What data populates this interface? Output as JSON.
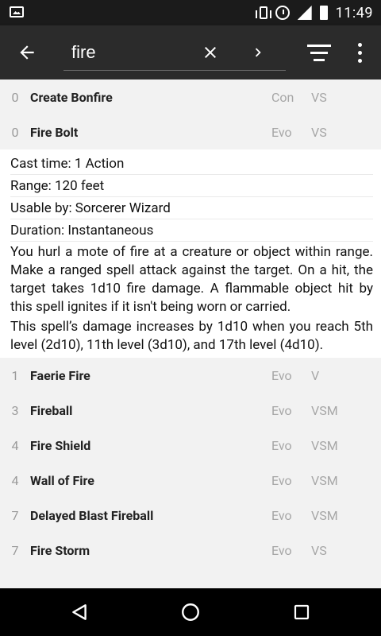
{
  "status_bar": {
    "time": "11:49"
  },
  "search": {
    "value": "fire",
    "placeholder": ""
  },
  "spells_top": [
    {
      "level": "0",
      "name": "Create Bonfire",
      "school": "Con",
      "components": "VS"
    },
    {
      "level": "0",
      "name": "Fire Bolt",
      "school": "Evo",
      "components": "VS"
    }
  ],
  "detail": {
    "cast_time": "Cast time: 1 Action",
    "range": "Range: 120 feet",
    "usable_by": "Usable by: Sorcerer Wizard",
    "duration": "Duration: Instantaneous",
    "description_1": "You hurl a mote of fire at a creature or object within range. Make a ranged spell attack against the target. On a hit, the target takes 1d10 fire damage. A flammable object hit by this spell ignites if it isn't being worn or carried.",
    "description_2": "This spell’s damage increases by 1d10 when you reach 5th level (2d10), 11th level (3d10), and 17th level (4d10)."
  },
  "spells_bottom": [
    {
      "level": "1",
      "name": "Faerie Fire",
      "school": "Evo",
      "components": "V"
    },
    {
      "level": "3",
      "name": "Fireball",
      "school": "Evo",
      "components": "VSM"
    },
    {
      "level": "4",
      "name": "Fire Shield",
      "school": "Evo",
      "components": "VSM"
    },
    {
      "level": "4",
      "name": "Wall of Fire",
      "school": "Evo",
      "components": "VSM"
    },
    {
      "level": "7",
      "name": "Delayed Blast Fireball",
      "school": "Evo",
      "components": "VSM"
    },
    {
      "level": "7",
      "name": "Fire Storm",
      "school": "Evo",
      "components": "VS"
    }
  ]
}
